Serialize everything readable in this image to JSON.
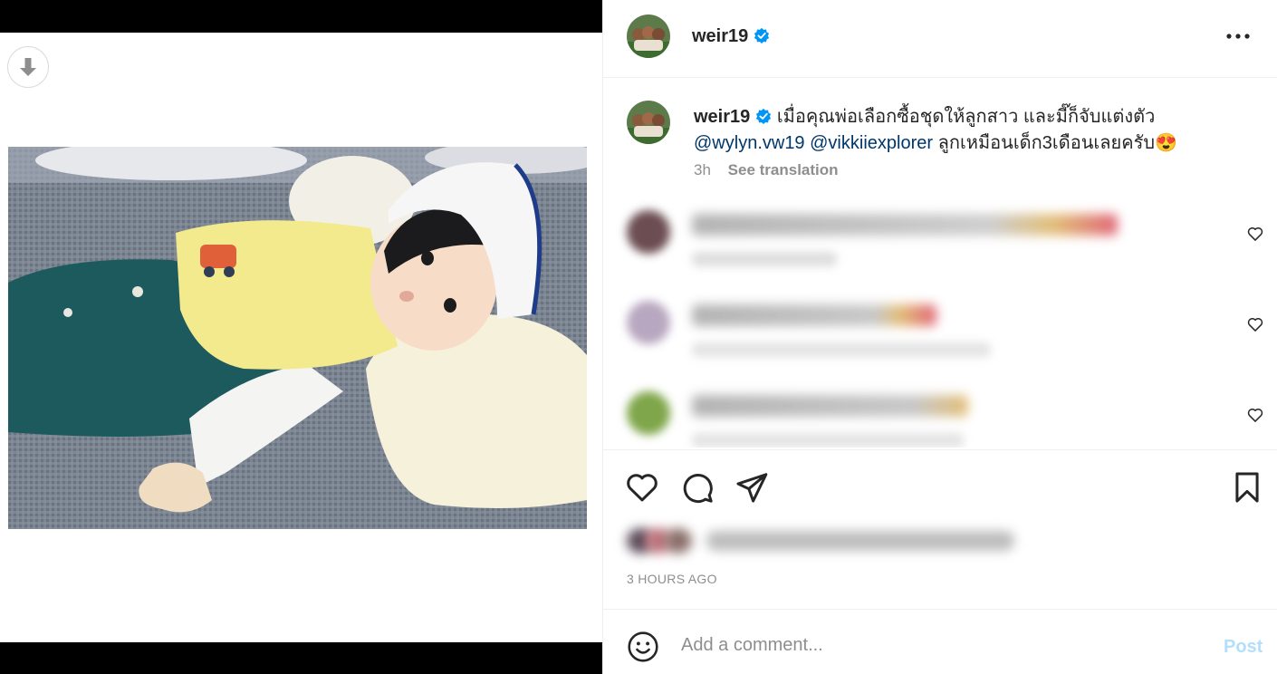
{
  "post": {
    "username": "weir19",
    "verified": true,
    "caption_text": "เมื่อคุณพ่อเลือกซื้อชุดให้ลูกสาว และมี๊ก็จับแต่งตัว ",
    "mention_1": "@wylyn.vw19",
    "mention_2": "@vikkiiexplorer",
    "caption_tail": " ลูกเหมือนเด็ก3เดือนเลยครับ",
    "caption_emoji": "😍",
    "caption_age": "3h",
    "see_translation": "See translation",
    "timestamp": "3 HOURS AGO"
  },
  "colors": {
    "accent_blue": "#0095f6",
    "post_button_disabled": "#b2dffc",
    "mention": "#00376b",
    "muted": "#8e8e8e",
    "text": "#262626"
  },
  "icons": {
    "download": "arrow-down-icon",
    "verified": "verified-badge-icon",
    "more": "more-options-icon",
    "like": "heart-icon",
    "comment": "comment-bubble-icon",
    "share": "paper-plane-icon",
    "save": "bookmark-icon",
    "emoji": "smiley-icon"
  },
  "comment_box": {
    "placeholder": "Add a comment...",
    "post_label": "Post"
  }
}
